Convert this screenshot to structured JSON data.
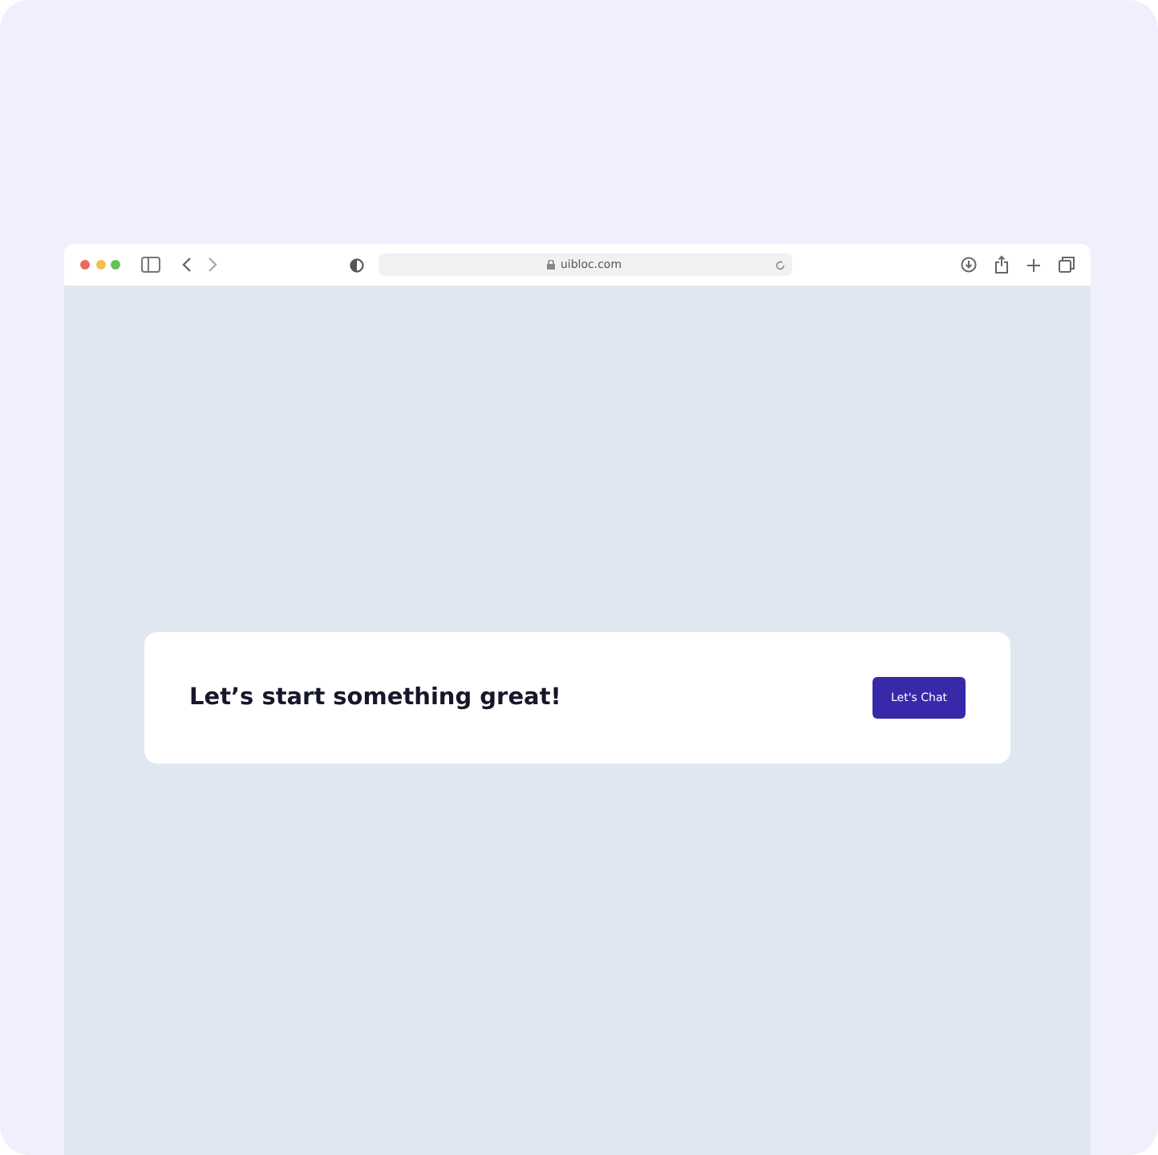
{
  "browser": {
    "url": "uibloc.com"
  },
  "cta": {
    "heading": "Let’s start something great!",
    "button": "Let's Chat"
  }
}
